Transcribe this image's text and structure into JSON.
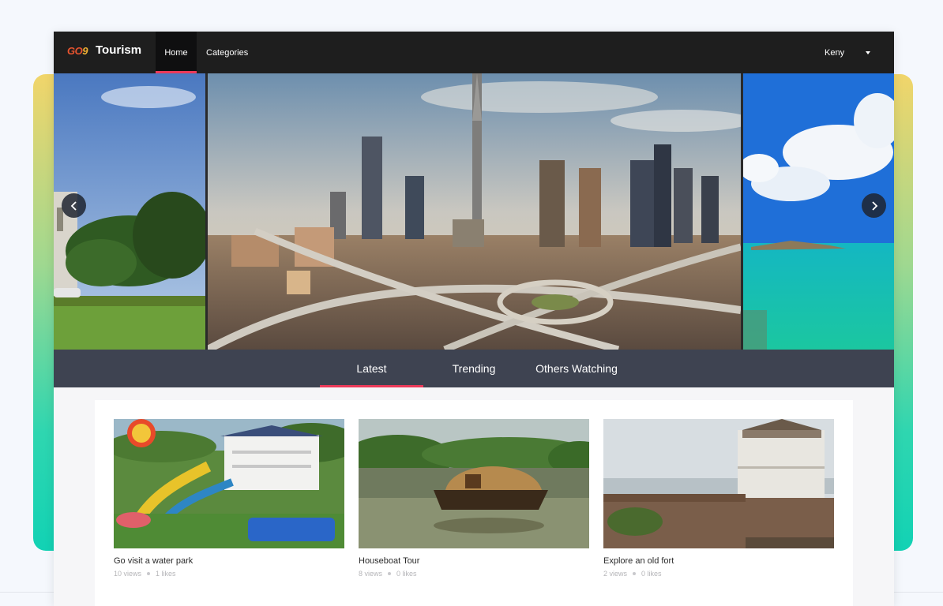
{
  "navbar": {
    "logo_text_a": "GO",
    "logo_text_b": "9",
    "brand": "Tourism",
    "items": [
      {
        "label": "Home",
        "active": true
      },
      {
        "label": "Categories",
        "active": false
      }
    ],
    "user": "Keny",
    "active_color": "#ec3a5a"
  },
  "carousel": {
    "prev_icon": "chevron-left-icon",
    "next_icon": "chevron-right-icon"
  },
  "tabs": [
    {
      "label": "Latest",
      "active": true
    },
    {
      "label": "Trending",
      "active": false
    },
    {
      "label": "Others Watching",
      "active": false
    }
  ],
  "cards": [
    {
      "title": "Go visit a water park",
      "views": "10 views",
      "likes": "1 likes"
    },
    {
      "title": "Houseboat Tour",
      "views": "8 views",
      "likes": "0 likes"
    },
    {
      "title": "Explore an old fort",
      "views": "2 views",
      "likes": "0 likes"
    }
  ]
}
